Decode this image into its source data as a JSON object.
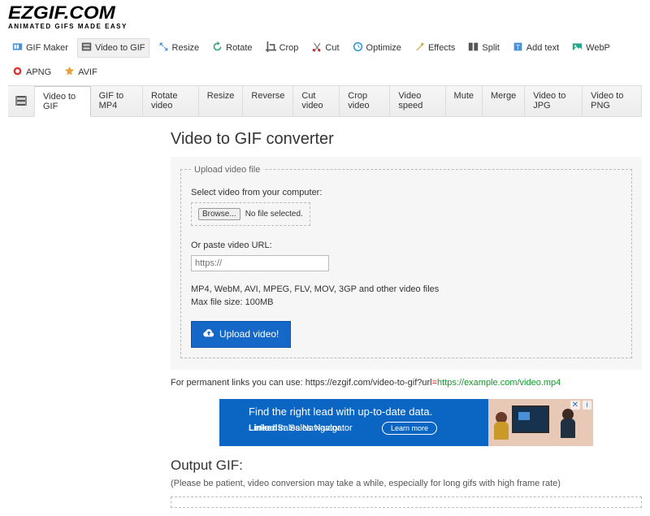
{
  "logo": {
    "main": "EZGIF.COM",
    "sub": "ANIMATED GIFS MADE EASY"
  },
  "nav1": [
    {
      "key": "gif-maker",
      "label": "GIF Maker"
    },
    {
      "key": "video-to-gif",
      "label": "Video to GIF",
      "active": true
    },
    {
      "key": "resize",
      "label": "Resize"
    },
    {
      "key": "rotate",
      "label": "Rotate"
    },
    {
      "key": "crop",
      "label": "Crop"
    },
    {
      "key": "cut",
      "label": "Cut"
    },
    {
      "key": "optimize",
      "label": "Optimize"
    },
    {
      "key": "effects",
      "label": "Effects"
    },
    {
      "key": "split",
      "label": "Split"
    },
    {
      "key": "add-text",
      "label": "Add text"
    },
    {
      "key": "webp",
      "label": "WebP"
    },
    {
      "key": "apng",
      "label": "APNG"
    },
    {
      "key": "avif",
      "label": "AVIF"
    }
  ],
  "nav2": [
    {
      "key": "video-to-gif",
      "label": "Video to GIF",
      "active": true
    },
    {
      "key": "gif-to-mp4",
      "label": "GIF to MP4"
    },
    {
      "key": "rotate-video",
      "label": "Rotate video"
    },
    {
      "key": "resize",
      "label": "Resize"
    },
    {
      "key": "reverse",
      "label": "Reverse"
    },
    {
      "key": "cut-video",
      "label": "Cut video"
    },
    {
      "key": "crop-video",
      "label": "Crop video"
    },
    {
      "key": "video-speed",
      "label": "Video speed"
    },
    {
      "key": "mute",
      "label": "Mute"
    },
    {
      "key": "merge",
      "label": "Merge"
    },
    {
      "key": "video-to-jpg",
      "label": "Video to JPG"
    },
    {
      "key": "video-to-png",
      "label": "Video to PNG"
    }
  ],
  "page": {
    "title": "Video to GIF converter",
    "legend": "Upload video file",
    "select_label": "Select video from your computer:",
    "browse": "Browse...",
    "file_status": "No file selected.",
    "or_paste": "Or paste video URL:",
    "url_placeholder": "https://",
    "formats_line1": "MP4, WebM, AVI, MPEG, FLV, MOV, 3GP and other video files",
    "formats_line2": "Max file size: 100MB",
    "upload_btn": "Upload video!",
    "permalink_prefix": "For permanent links you can use: https://ezgif.com/video-to-gif?url",
    "permalink_eq": "=",
    "permalink_example": "https://example.com/video.mp4",
    "output_heading": "Output GIF:",
    "output_note": "(Please be patient, video conversion may take a while, especially for long gifs with high frame rate)"
  },
  "ad": {
    "headline": "Find the right lead with up-to-date data.",
    "brand_in": "in",
    "brand_txt": "Linked     Sales Navigator",
    "cta": "Learn more"
  }
}
